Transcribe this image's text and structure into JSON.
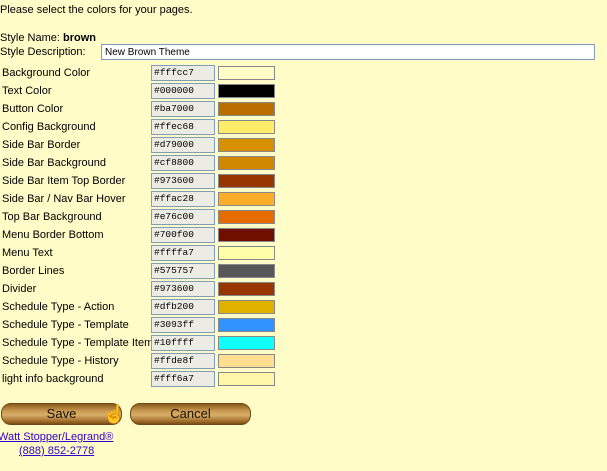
{
  "intro": "Please select the colors for your pages.",
  "style_name_label": "Style Name:",
  "style_name": "brown",
  "style_desc_label": "Style Description:",
  "style_desc": "New Brown Theme",
  "colors": [
    {
      "label": "Background Color",
      "hex": "#fffcc7"
    },
    {
      "label": "Text Color",
      "hex": "#000000"
    },
    {
      "label": "Button Color",
      "hex": "#ba7000"
    },
    {
      "label": "Config Background",
      "hex": "#ffec68"
    },
    {
      "label": "Side Bar Border",
      "hex": "#d79000"
    },
    {
      "label": "Side Bar Background",
      "hex": "#cf8800"
    },
    {
      "label": "Side Bar Item Top Border",
      "hex": "#973600"
    },
    {
      "label": "Side Bar / Nav Bar Hover",
      "hex": "#ffac28"
    },
    {
      "label": "Top Bar Background",
      "hex": "#e76c00"
    },
    {
      "label": "Menu Border Bottom",
      "hex": "#700f00"
    },
    {
      "label": "Menu Text",
      "hex": "#ffffa7"
    },
    {
      "label": "Border Lines",
      "hex": "#575757"
    },
    {
      "label": "Divider",
      "hex": "#973600"
    },
    {
      "label": "Schedule Type - Action",
      "hex": "#dfb200"
    },
    {
      "label": "Schedule Type - Template",
      "hex": "#3093ff"
    },
    {
      "label": "Schedule Type - Template Item",
      "hex": "#10ffff"
    },
    {
      "label": "Schedule Type - History",
      "hex": "#ffde8f"
    },
    {
      "label": "light info background",
      "hex": "#fff6a7"
    }
  ],
  "buttons": {
    "save": "Save",
    "cancel": "Cancel"
  },
  "footer": {
    "company": "Watt Stopper/Legrand®",
    "phone": "(888) 852-2778"
  }
}
